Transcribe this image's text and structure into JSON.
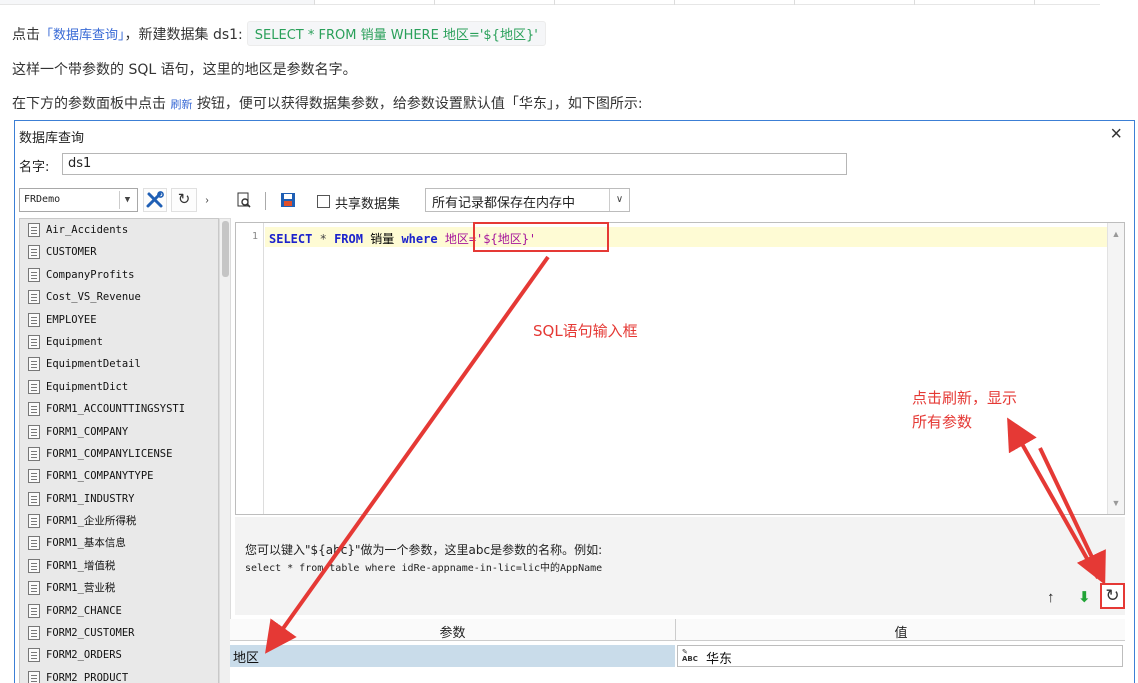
{
  "article": {
    "p1_prefix": "点击",
    "p1_link": "「数据库查询」",
    "p1_mid": "，新建数据集 ds1:",
    "p1_code": "SELECT * FROM 销量 WHERE 地区='${地区}'",
    "p2": "这样一个带参数的 SQL 语句，这里的地区是参数名字。",
    "p3_prefix": "在下方的参数面板中点击",
    "p3_link": "刷新",
    "p3_suffix": "按钮，便可以获得数据集参数，给参数设置默认值「华东」，如下图所示:"
  },
  "dialog": {
    "title": "数据库查询",
    "close": "×",
    "name_label": "名字:",
    "name_value": "ds1",
    "connection": "FRDemo",
    "share_label": "共享数据集",
    "cache_option": "所有记录都保存在内存中",
    "tables": [
      "Air_Accidents",
      "CUSTOMER",
      "CompanyProfits",
      "Cost_VS_Revenue",
      "EMPLOYEE",
      "Equipment",
      "EquipmentDetail",
      "EquipmentDict",
      "FORM1_ACCOUNTTINGSYSTI",
      "FORM1_COMPANY",
      "FORM1_COMPANYLICENSE",
      "FORM1_COMPANYTYPE",
      "FORM1_INDUSTRY",
      "FORM1_企业所得税",
      "FORM1_基本信息",
      "FORM1_增值税",
      "FORM1_营业税",
      "FORM2_CHANCE",
      "FORM2_CUSTOMER",
      "FORM2_ORDERS",
      "FORM2_PRODUCT"
    ],
    "sql": {
      "line_no": "1",
      "kw_select": "SELECT",
      "star": "*",
      "kw_from": "FROM",
      "table": "销量",
      "kw_where": "where",
      "condition": "地区='${地区}'"
    },
    "hint_line1": "您可以键入\"${abc}\"做为一个参数，这里abc是参数的名称。例如:",
    "hint_line2": "select * from table where idRe-appname-in-lic=lic中的AppName",
    "params_header_name": "参数",
    "params_header_value": "值",
    "params": [
      {
        "name": "地区",
        "value": "华东"
      }
    ]
  },
  "annotations": {
    "sql_input": "SQL语句输入框",
    "refresh_line1": "点击刷新，显示",
    "refresh_line2": "所有参数"
  },
  "colors": {
    "annotation_red": "#e53935",
    "window_border": "#3c7fd5",
    "sql_highlight": "#fefbd4",
    "param_row": "#c9dcea"
  }
}
